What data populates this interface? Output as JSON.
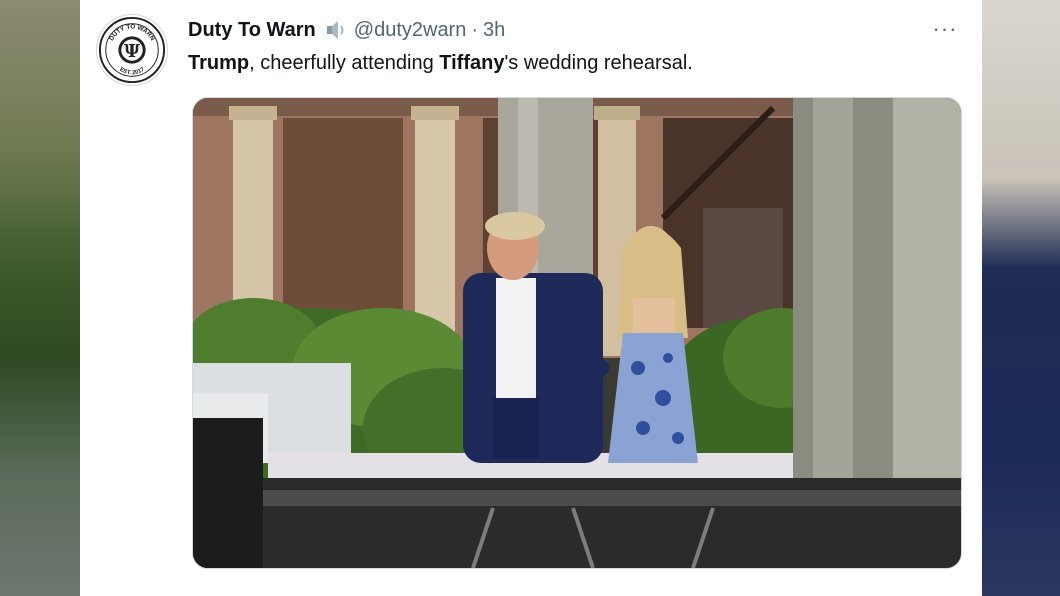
{
  "tweet": {
    "display_name": "Duty To Warn",
    "handle": "@duty2warn",
    "separator": "·",
    "time": "3h",
    "more_label": "···",
    "text": {
      "strong_1": "Trump",
      "part_1": ", cheerfully attending ",
      "strong_2": "Tiffany",
      "part_2": "'s wedding rehearsal."
    }
  },
  "avatar": {
    "top_text": "DUTY TO WARN",
    "bottom_text": "EST. 2017",
    "symbol": "Ψ"
  },
  "icons": {
    "speaker": "speaker-icon",
    "more": "more-icon",
    "avatar": "duty-to-warn-logo"
  },
  "colors": {
    "primary_text": "#0f1419",
    "secondary_text": "#536471",
    "border": "#cfd9de"
  }
}
